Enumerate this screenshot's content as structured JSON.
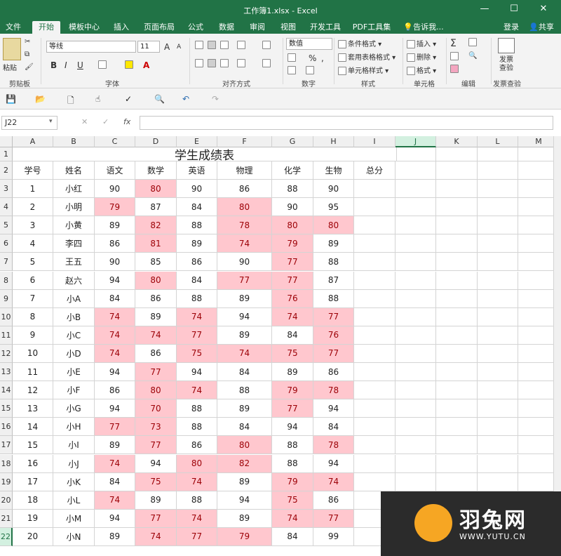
{
  "window": {
    "title": "工作簿1.xlsx - Excel",
    "minimize": "—",
    "restore": "☐",
    "close": "✕"
  },
  "tabs": [
    "文件",
    "开始",
    "模板中心",
    "插入",
    "页面布局",
    "公式",
    "数据",
    "审阅",
    "视图",
    "开发工具",
    "PDF工具集"
  ],
  "active_tab": "开始",
  "tell_me": "告诉我...",
  "login": "登录",
  "share": "共享",
  "ribbon": {
    "paste": "粘贴",
    "clipboard": "剪贴板",
    "font_name": "等线",
    "font_size": "11",
    "font_grow": "A",
    "font_shrink": "A",
    "bold": "B",
    "italic": "I",
    "underline": "U",
    "font_label": "字体",
    "align_label": "对齐方式",
    "number_format": "数值",
    "currency": "%",
    "comma": ",",
    "number_label": "数字",
    "cond_format": "条件格式",
    "table_format": "套用表格格式",
    "cell_style": "单元格样式",
    "style_label": "样式",
    "insert": "插入",
    "delete": "删除",
    "format": "格式",
    "cells_label": "单元格",
    "edit_label": "编辑",
    "invoice_check": "发票查验",
    "invoice_label": "发票查验"
  },
  "name_box": "J22",
  "fx": "fx",
  "columns": [
    "A",
    "B",
    "C",
    "D",
    "E",
    "F",
    "G",
    "H",
    "I",
    "J",
    "K",
    "L",
    "M"
  ],
  "selected_column": "J",
  "selected_row": "22",
  "sheet_title": "学生成绩表",
  "headers": [
    "学号",
    "姓名",
    "语文",
    "数学",
    "英语",
    "物理",
    "化学",
    "生物",
    "总分"
  ],
  "rows": [
    {
      "id": "1",
      "name": "小红",
      "scores": [
        "90",
        "80",
        "90",
        "86",
        "88",
        "90"
      ],
      "pink": [
        false,
        true,
        false,
        false,
        false,
        false
      ]
    },
    {
      "id": "2",
      "name": "小明",
      "scores": [
        "79",
        "87",
        "84",
        "80",
        "90",
        "95"
      ],
      "pink": [
        true,
        false,
        false,
        true,
        false,
        false
      ]
    },
    {
      "id": "3",
      "name": "小黄",
      "scores": [
        "89",
        "82",
        "88",
        "78",
        "80",
        "80"
      ],
      "pink": [
        false,
        true,
        false,
        true,
        true,
        true
      ]
    },
    {
      "id": "4",
      "name": "李四",
      "scores": [
        "86",
        "81",
        "89",
        "74",
        "79",
        "89"
      ],
      "pink": [
        false,
        true,
        false,
        true,
        true,
        false
      ]
    },
    {
      "id": "5",
      "name": "王五",
      "scores": [
        "90",
        "85",
        "86",
        "90",
        "77",
        "88"
      ],
      "pink": [
        false,
        false,
        false,
        false,
        true,
        false
      ]
    },
    {
      "id": "6",
      "name": "赵六",
      "scores": [
        "94",
        "80",
        "84",
        "77",
        "77",
        "87"
      ],
      "pink": [
        false,
        true,
        false,
        true,
        true,
        false
      ]
    },
    {
      "id": "7",
      "name": "小A",
      "scores": [
        "84",
        "86",
        "88",
        "89",
        "76",
        "88"
      ],
      "pink": [
        false,
        false,
        false,
        false,
        true,
        false
      ]
    },
    {
      "id": "8",
      "name": "小B",
      "scores": [
        "74",
        "89",
        "74",
        "94",
        "74",
        "77"
      ],
      "pink": [
        true,
        false,
        true,
        false,
        true,
        true
      ]
    },
    {
      "id": "9",
      "name": "小C",
      "scores": [
        "74",
        "74",
        "77",
        "89",
        "84",
        "76"
      ],
      "pink": [
        true,
        true,
        true,
        false,
        false,
        true
      ]
    },
    {
      "id": "10",
      "name": "小D",
      "scores": [
        "74",
        "86",
        "75",
        "74",
        "75",
        "77"
      ],
      "pink": [
        true,
        false,
        true,
        true,
        true,
        true
      ]
    },
    {
      "id": "11",
      "name": "小E",
      "scores": [
        "94",
        "77",
        "94",
        "84",
        "89",
        "86"
      ],
      "pink": [
        false,
        true,
        false,
        false,
        false,
        false
      ]
    },
    {
      "id": "12",
      "name": "小F",
      "scores": [
        "86",
        "80",
        "74",
        "88",
        "79",
        "78"
      ],
      "pink": [
        false,
        true,
        true,
        false,
        true,
        true
      ]
    },
    {
      "id": "13",
      "name": "小G",
      "scores": [
        "94",
        "70",
        "88",
        "89",
        "77",
        "94"
      ],
      "pink": [
        false,
        true,
        false,
        false,
        true,
        false
      ]
    },
    {
      "id": "14",
      "name": "小H",
      "scores": [
        "77",
        "73",
        "88",
        "84",
        "94",
        "84"
      ],
      "pink": [
        true,
        true,
        false,
        false,
        false,
        false
      ]
    },
    {
      "id": "15",
      "name": "小I",
      "scores": [
        "89",
        "77",
        "86",
        "80",
        "88",
        "78"
      ],
      "pink": [
        false,
        true,
        false,
        true,
        false,
        true
      ]
    },
    {
      "id": "16",
      "name": "小J",
      "scores": [
        "74",
        "94",
        "80",
        "82",
        "88",
        "94"
      ],
      "pink": [
        true,
        false,
        true,
        true,
        false,
        false
      ]
    },
    {
      "id": "17",
      "name": "小K",
      "scores": [
        "84",
        "75",
        "74",
        "89",
        "79",
        "74"
      ],
      "pink": [
        false,
        true,
        true,
        false,
        true,
        true
      ]
    },
    {
      "id": "18",
      "name": "小L",
      "scores": [
        "74",
        "89",
        "88",
        "94",
        "75",
        "86"
      ],
      "pink": [
        true,
        false,
        false,
        false,
        true,
        false
      ]
    },
    {
      "id": "19",
      "name": "小M",
      "scores": [
        "94",
        "77",
        "74",
        "89",
        "74",
        "77"
      ],
      "pink": [
        false,
        true,
        true,
        false,
        true,
        true
      ]
    },
    {
      "id": "20",
      "name": "小N",
      "scores": [
        "89",
        "74",
        "77",
        "79",
        "84",
        "99"
      ],
      "pink": [
        false,
        true,
        true,
        true,
        false,
        false
      ]
    }
  ],
  "watermark": {
    "name": "羽兔网",
    "url": "WWW.YUTU.CN"
  },
  "colors": {
    "excel_green": "#217346",
    "pink_fill": "#ffc7ce",
    "pink_text": "#9c0006"
  }
}
